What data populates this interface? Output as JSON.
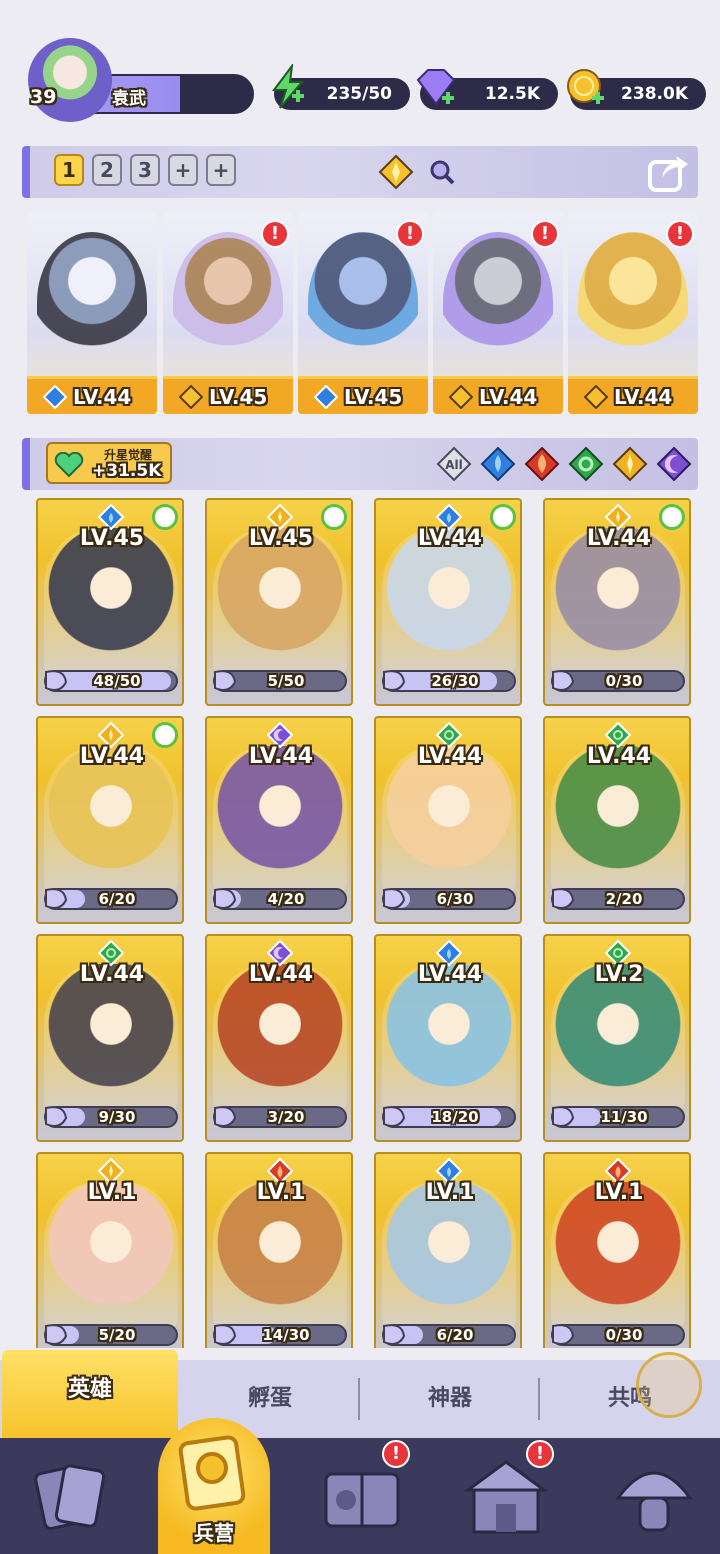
{
  "player": {
    "level": "39",
    "name": "袁武"
  },
  "currencies": [
    {
      "id": "energy",
      "value": "235/50",
      "icon": "energy-bolt-icon"
    },
    {
      "id": "gem",
      "value": "12.5K",
      "icon": "purple-gem-icon"
    },
    {
      "id": "gold",
      "value": "238.0K",
      "icon": "gold-coin-icon"
    }
  ],
  "team_tabs": [
    "1",
    "2",
    "3",
    "+",
    "+"
  ],
  "team_slots": [
    {
      "level": "LV.44",
      "element": "water",
      "alert": false
    },
    {
      "level": "LV.45",
      "element": "light",
      "alert": true
    },
    {
      "level": "LV.45",
      "element": "water",
      "alert": true
    },
    {
      "level": "LV.44",
      "element": "light",
      "alert": true
    },
    {
      "level": "LV.44",
      "element": "light",
      "alert": true
    }
  ],
  "awaken": {
    "title": "升星觉醒",
    "value": "+31.5K"
  },
  "filters": [
    "All",
    "water",
    "fire",
    "wind",
    "light",
    "dark"
  ],
  "filter_all_label": "All",
  "alert_mark": "!",
  "heroes": [
    {
      "level": "LV.45",
      "element": "water",
      "progress": "48/50",
      "ratio": 0.96,
      "checked": true,
      "art": "#3b3f55"
    },
    {
      "level": "LV.45",
      "element": "light",
      "progress": "5/50",
      "ratio": 0.1,
      "checked": true,
      "art": "#d8a868"
    },
    {
      "level": "LV.44",
      "element": "water",
      "progress": "26/30",
      "ratio": 0.87,
      "checked": true,
      "art": "#c9d8ee"
    },
    {
      "level": "LV.44",
      "element": "light",
      "progress": "0/30",
      "ratio": 0.0,
      "checked": true,
      "art": "#9a8fa8"
    },
    {
      "level": "LV.44",
      "element": "light",
      "progress": "6/20",
      "ratio": 0.3,
      "checked": true,
      "art": "#e8c45a"
    },
    {
      "level": "LV.44",
      "element": "dark",
      "progress": "4/20",
      "ratio": 0.2,
      "checked": false,
      "art": "#7a5aa8"
    },
    {
      "level": "LV.44",
      "element": "wind",
      "progress": "6/30",
      "ratio": 0.2,
      "checked": false,
      "art": "#f6d0a0"
    },
    {
      "level": "LV.44",
      "element": "wind",
      "progress": "2/20",
      "ratio": 0.1,
      "checked": false,
      "art": "#4c8f4a"
    },
    {
      "level": "LV.44",
      "element": "wind",
      "progress": "9/30",
      "ratio": 0.3,
      "checked": false,
      "art": "#4a4650"
    },
    {
      "level": "LV.44",
      "element": "dark",
      "progress": "3/20",
      "ratio": 0.15,
      "checked": false,
      "art": "#b84a2a"
    },
    {
      "level": "LV.44",
      "element": "water",
      "progress": "18/20",
      "ratio": 0.9,
      "checked": false,
      "art": "#8ac4e6"
    },
    {
      "level": "LV.2",
      "element": "wind",
      "progress": "11/30",
      "ratio": 0.37,
      "checked": false,
      "art": "#3a8f7a"
    },
    {
      "level": "LV.1",
      "element": "light",
      "progress": "5/20",
      "ratio": 0.25,
      "checked": false,
      "art": "#f2c8c0"
    },
    {
      "level": "LV.1",
      "element": "fire",
      "progress": "14/30",
      "ratio": 0.47,
      "checked": false,
      "art": "#c8844a"
    },
    {
      "level": "LV.1",
      "element": "water",
      "progress": "6/20",
      "ratio": 0.3,
      "checked": false,
      "art": "#a8c8e6"
    },
    {
      "level": "LV.1",
      "element": "fire",
      "progress": "0/30",
      "ratio": 0.0,
      "checked": false,
      "art": "#d04a2a"
    }
  ],
  "subtabs": [
    "英雄",
    "孵蛋",
    "神器",
    "共鸣"
  ],
  "bottom_nav": [
    {
      "id": "cards",
      "icon": "cards-icon",
      "alert": false
    },
    {
      "id": "barracks",
      "label": "兵营",
      "icon": "barracks-icon",
      "alert": false
    },
    {
      "id": "book",
      "icon": "spellbook-icon",
      "alert": true
    },
    {
      "id": "shrine",
      "icon": "shrine-icon",
      "alert": true
    },
    {
      "id": "guild",
      "icon": "mushroom-icon",
      "alert": false
    }
  ],
  "colors": {
    "water": "#2f7fe0",
    "fire": "#d83a2a",
    "wind": "#2fa84a",
    "light": "#f0b020",
    "dark": "#7b4fd6",
    "accent": "#7d6fe6"
  }
}
